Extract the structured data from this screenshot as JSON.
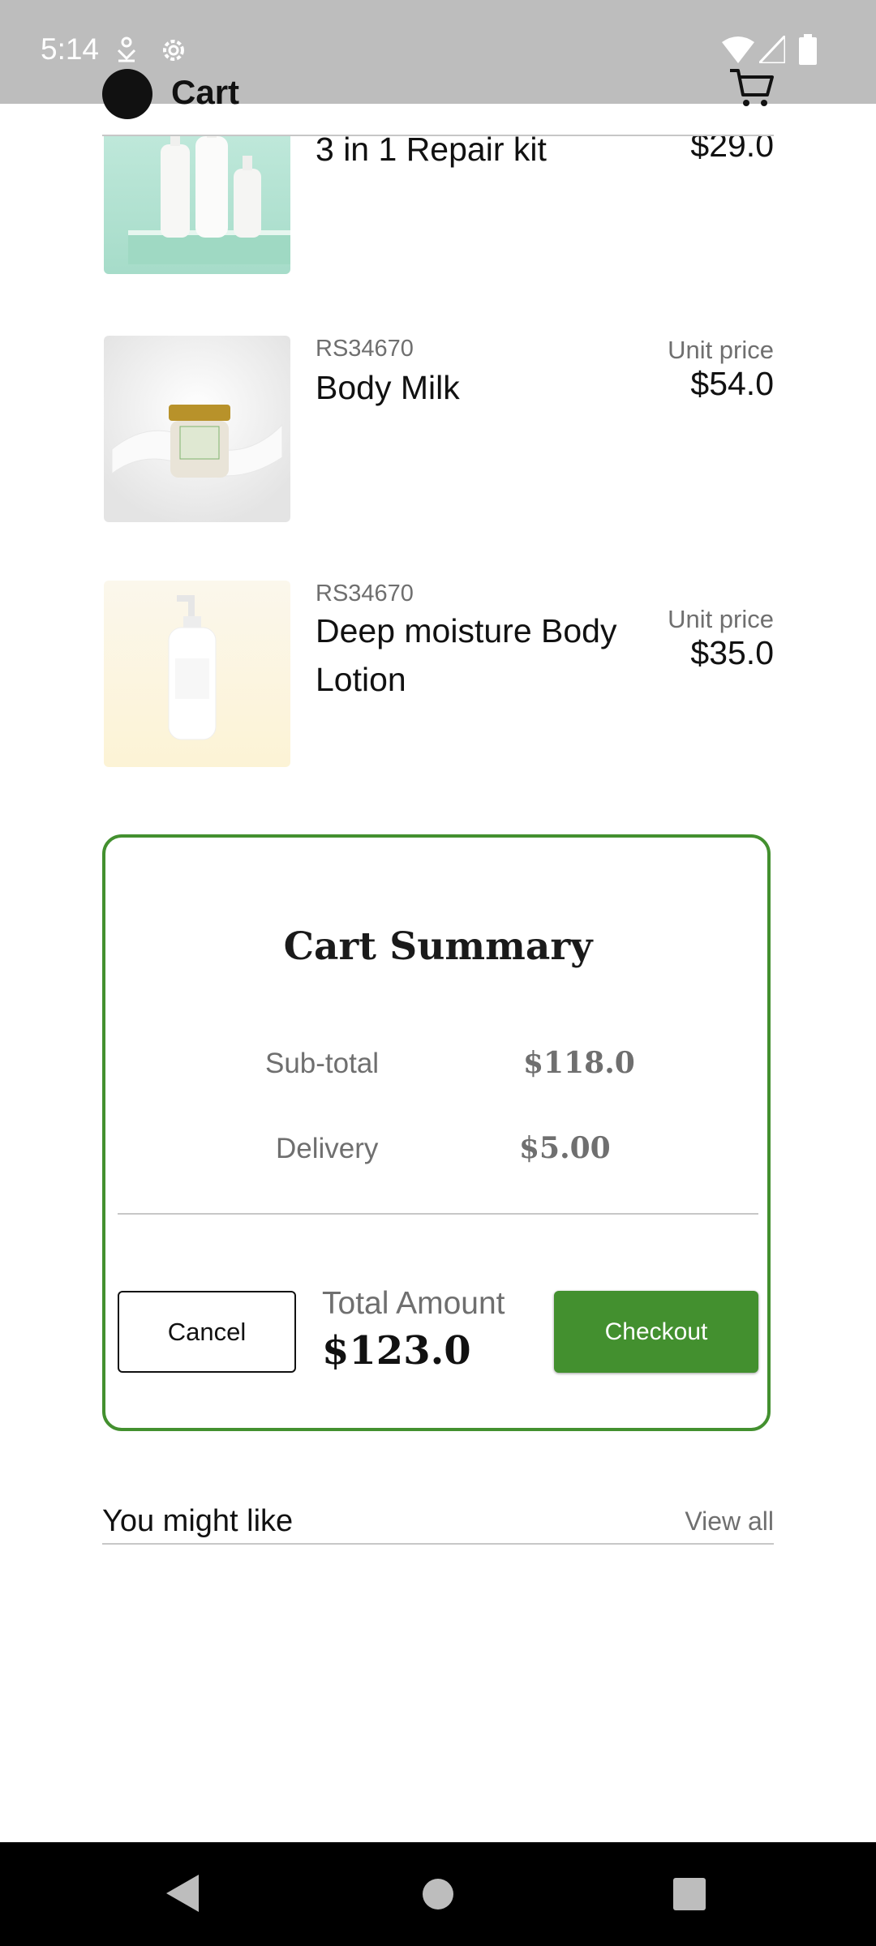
{
  "status_bar": {
    "time": "5:14"
  },
  "app_bar": {
    "title": "Cart"
  },
  "items": [
    {
      "code": "",
      "name": "3 in 1 Repair kit",
      "unit_label": "",
      "price": "$29.0"
    },
    {
      "code": "RS34670",
      "name": "Body Milk",
      "unit_label": "Unit price",
      "price": "$54.0"
    },
    {
      "code": "RS34670",
      "name": "Deep moisture Body Lotion",
      "unit_label": "Unit price",
      "price": "$35.0"
    }
  ],
  "summary": {
    "title": "Cart Summary",
    "subtotal_label": "Sub-total",
    "subtotal_value": "$118.0",
    "delivery_label": "Delivery",
    "delivery_value": "$5.00",
    "cancel_label": "Cancel",
    "total_label": "Total Amount",
    "total_value": "$123.0",
    "checkout_label": "Checkout"
  },
  "recommendations": {
    "title": "You might like",
    "view_all": "View all"
  },
  "colors": {
    "accent": "#43902f",
    "status_bar": "#bdbdbd",
    "muted_text": "#6f6f6f"
  },
  "icons": [
    "download-icon",
    "settings-icon",
    "wifi-icon",
    "signal-icon",
    "battery-icon",
    "cart-icon",
    "back-icon",
    "home-icon",
    "recents-icon"
  ]
}
